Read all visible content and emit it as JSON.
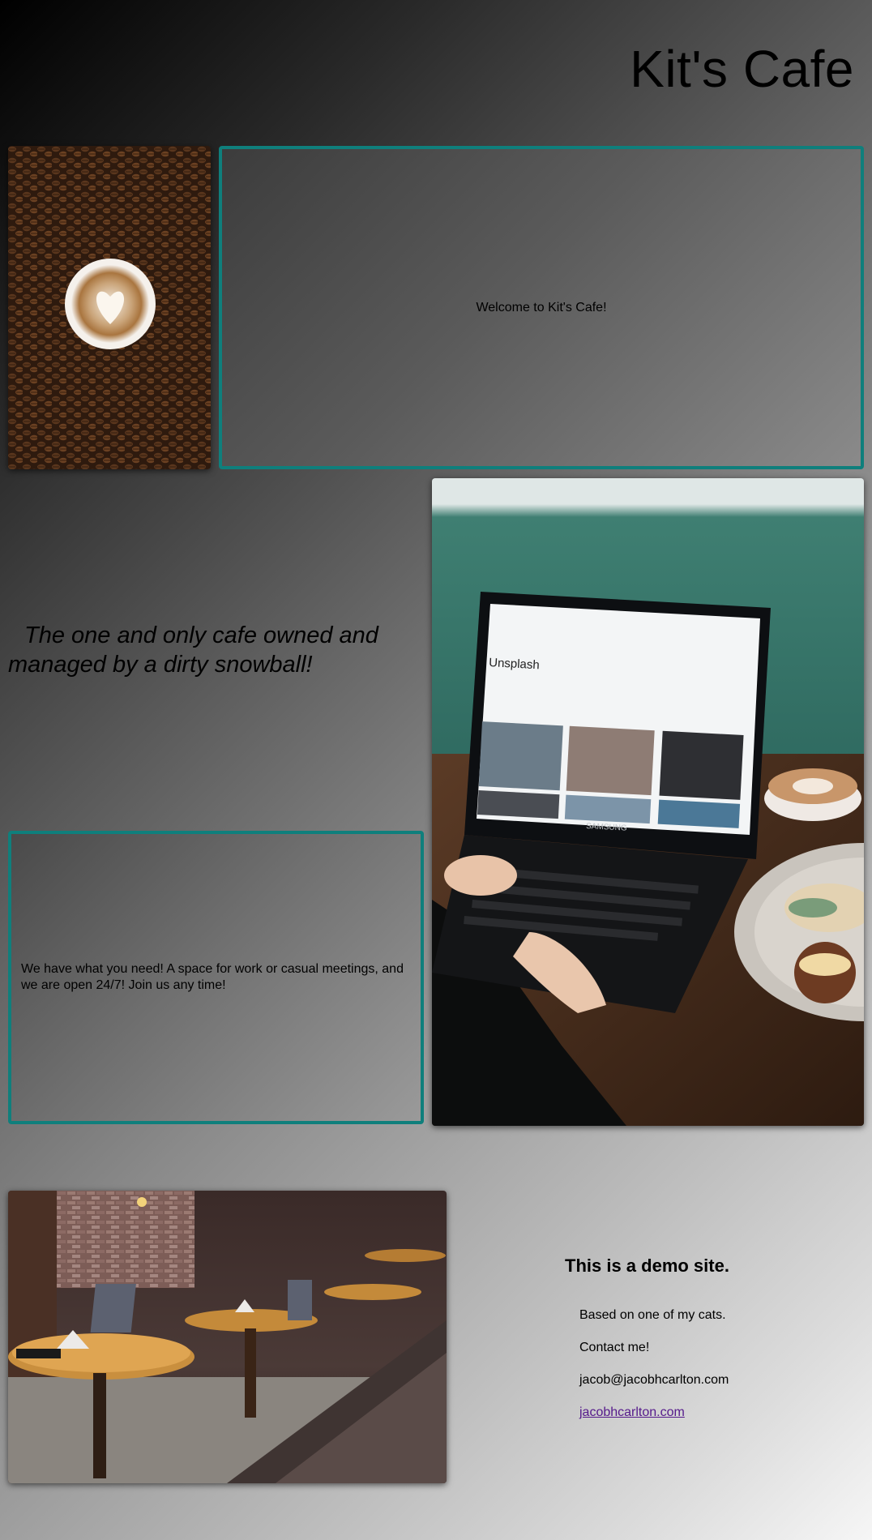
{
  "header": {
    "title": "Kit's Cafe"
  },
  "welcome": {
    "text": "Welcome to Kit's Cafe!"
  },
  "tagline": {
    "text": "The one and only cafe owned and managed by a dirty snowball!"
  },
  "info": {
    "text": "We have what you need! A space for work or casual meetings, and we are open 24/7! Join us any time!"
  },
  "demo": {
    "title": "This is a demo site.",
    "based_on": "Based on one of my cats.",
    "contact": "Contact me!",
    "email": "jacob@jacobhcarlton.com",
    "website": "jacobhcarlton.com"
  },
  "laptop_screen": {
    "site_name": "Unsplash",
    "brand": "SAMSUNG"
  },
  "colors": {
    "frame_border": "#0f7f7c",
    "link": "#551a8b"
  }
}
